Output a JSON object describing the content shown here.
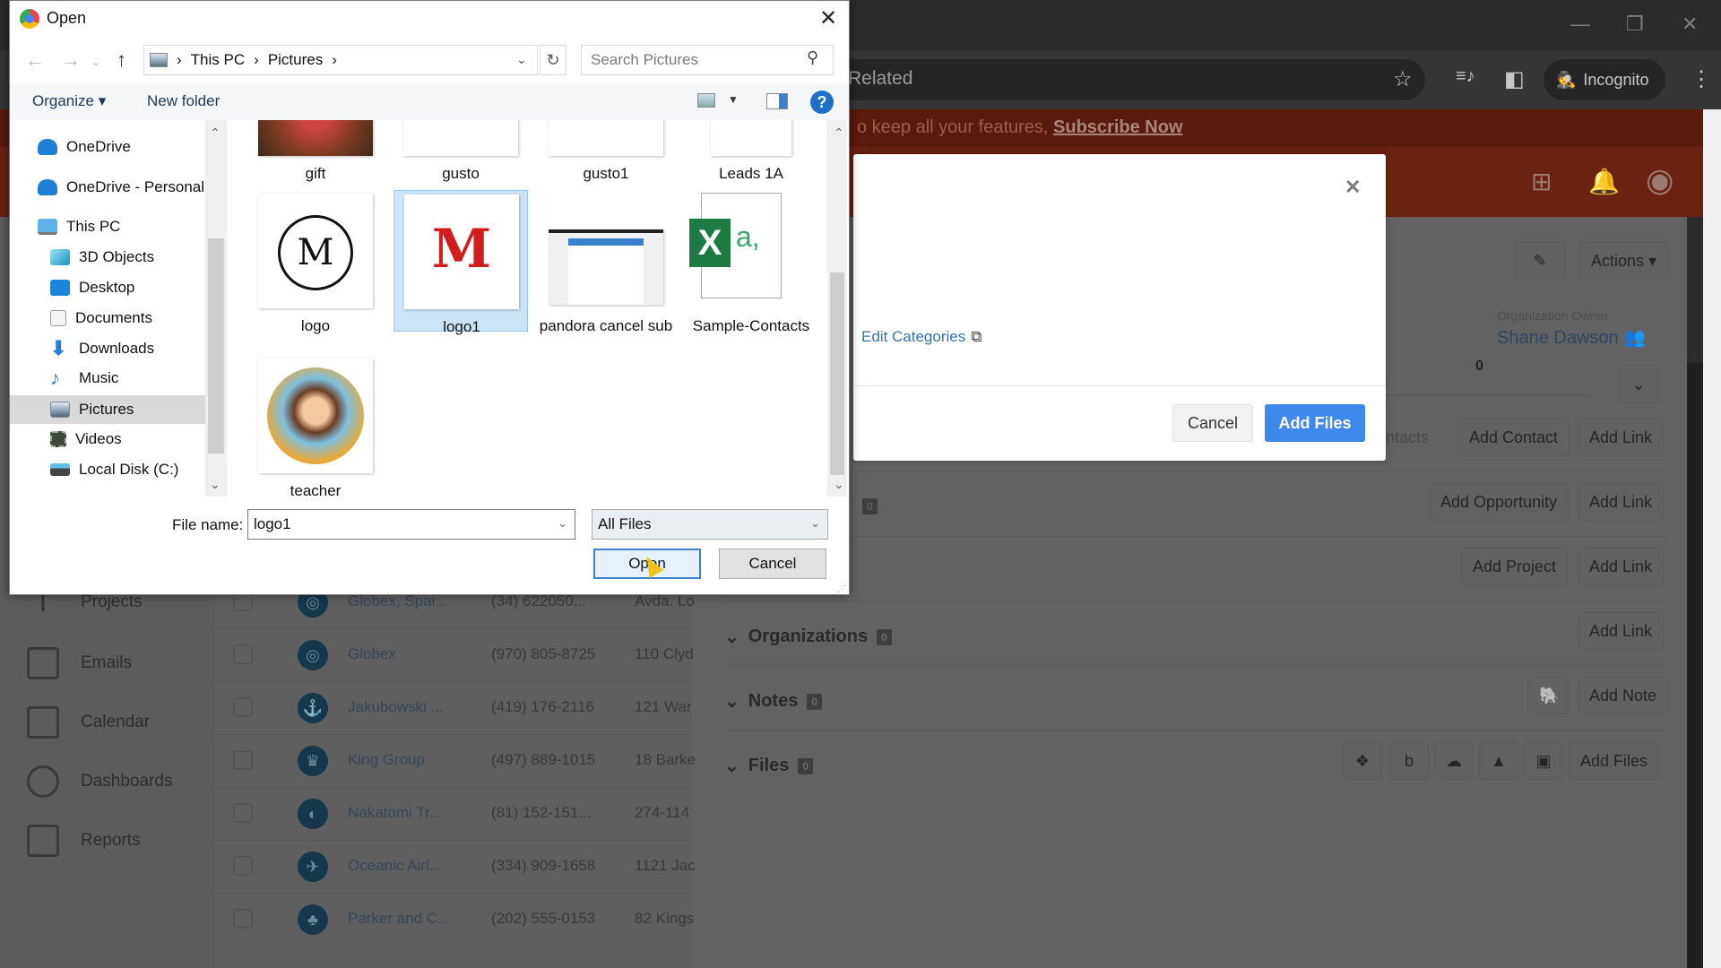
{
  "browser": {
    "omnibox_text": "Related",
    "incognito_label": "Incognito",
    "window_controls": [
      "minimize",
      "restore",
      "close"
    ]
  },
  "crm": {
    "banner_text": "o keep all your features,",
    "banner_link": "Subscribe Now",
    "actions_label": "Actions",
    "owner_label": "Organization Owner",
    "owner_name": "Shane Dawson",
    "owner_value_zero": "0",
    "sidebar": [
      {
        "label": "Projects",
        "icon": "projects-icon"
      },
      {
        "label": "Emails",
        "icon": "envelope-icon"
      },
      {
        "label": "Calendar",
        "icon": "calendar-icon"
      },
      {
        "label": "Dashboards",
        "icon": "gauge-icon"
      },
      {
        "label": "Reports",
        "icon": "bar-chart-icon"
      }
    ],
    "rows": [
      {
        "name": "Globex, Spai...",
        "phone": "(34) 622050...",
        "address": "Avda. Lo"
      },
      {
        "name": "Globex",
        "phone": "(970) 805-8725",
        "address": "110 Clyd"
      },
      {
        "name": "Jakubowski ...",
        "phone": "(419) 176-2116",
        "address": "121 War"
      },
      {
        "name": "King Group",
        "phone": "(497) 889-1015",
        "address": "18 Barke"
      },
      {
        "name": "Nakatomi Tr...",
        "phone": "(81) 152-151...",
        "address": "274-114"
      },
      {
        "name": "Oceanic Airl...",
        "phone": "(334) 909-1658",
        "address": "1121 Jac"
      },
      {
        "name": "Parker and C...",
        "phone": "(202) 555-0153",
        "address": "82 Kings"
      }
    ],
    "related": {
      "contacts_label": "ontacts",
      "add_contact": "Add Contact",
      "add_link": "Add Link",
      "add_opportunity": "Add Opportunity",
      "add_project": "Add Project",
      "opportunities_count": "0",
      "sections": [
        {
          "label": "Organizations",
          "count": "0",
          "buttons": [
            "Add Link"
          ]
        },
        {
          "label": "Notes",
          "count": "0",
          "buttons": [
            "Add Note"
          ]
        },
        {
          "label": "Files",
          "count": "0",
          "buttons": [
            "Add Files"
          ]
        }
      ]
    },
    "modal": {
      "edit_categories": "Edit Categories",
      "cancel": "Cancel",
      "add_files": "Add Files"
    }
  },
  "dialog": {
    "title": "Open",
    "breadcrumb": [
      "This PC",
      "Pictures"
    ],
    "search_placeholder": "Search Pictures",
    "organize": "Organize",
    "new_folder": "New folder",
    "nav": [
      {
        "label": "OneDrive",
        "icon": "cloud-icon"
      },
      {
        "label": "OneDrive - Personal",
        "icon": "cloud-icon"
      },
      {
        "label": "This PC",
        "icon": "computer-icon"
      },
      {
        "label": "3D Objects",
        "icon": "cube-icon"
      },
      {
        "label": "Desktop",
        "icon": "desktop-icon"
      },
      {
        "label": "Documents",
        "icon": "document-icon"
      },
      {
        "label": "Downloads",
        "icon": "download-icon"
      },
      {
        "label": "Music",
        "icon": "music-icon"
      },
      {
        "label": "Pictures",
        "icon": "pictures-icon",
        "selected": true
      },
      {
        "label": "Videos",
        "icon": "video-icon"
      },
      {
        "label": "Local Disk (C:)",
        "icon": "disk-icon"
      }
    ],
    "files": [
      {
        "name": "gift"
      },
      {
        "name": "gusto"
      },
      {
        "name": "gusto1"
      },
      {
        "name": "Leads 1A"
      },
      {
        "name": "logo"
      },
      {
        "name": "logo1",
        "selected": true
      },
      {
        "name": "pandora cancel sub"
      },
      {
        "name": "Sample-Contacts"
      },
      {
        "name": "teacher"
      }
    ],
    "file_name_label": "File name:",
    "file_name_value": "logo1",
    "file_type": "All Files",
    "open_button": "Open",
    "cancel_button": "Cancel"
  }
}
